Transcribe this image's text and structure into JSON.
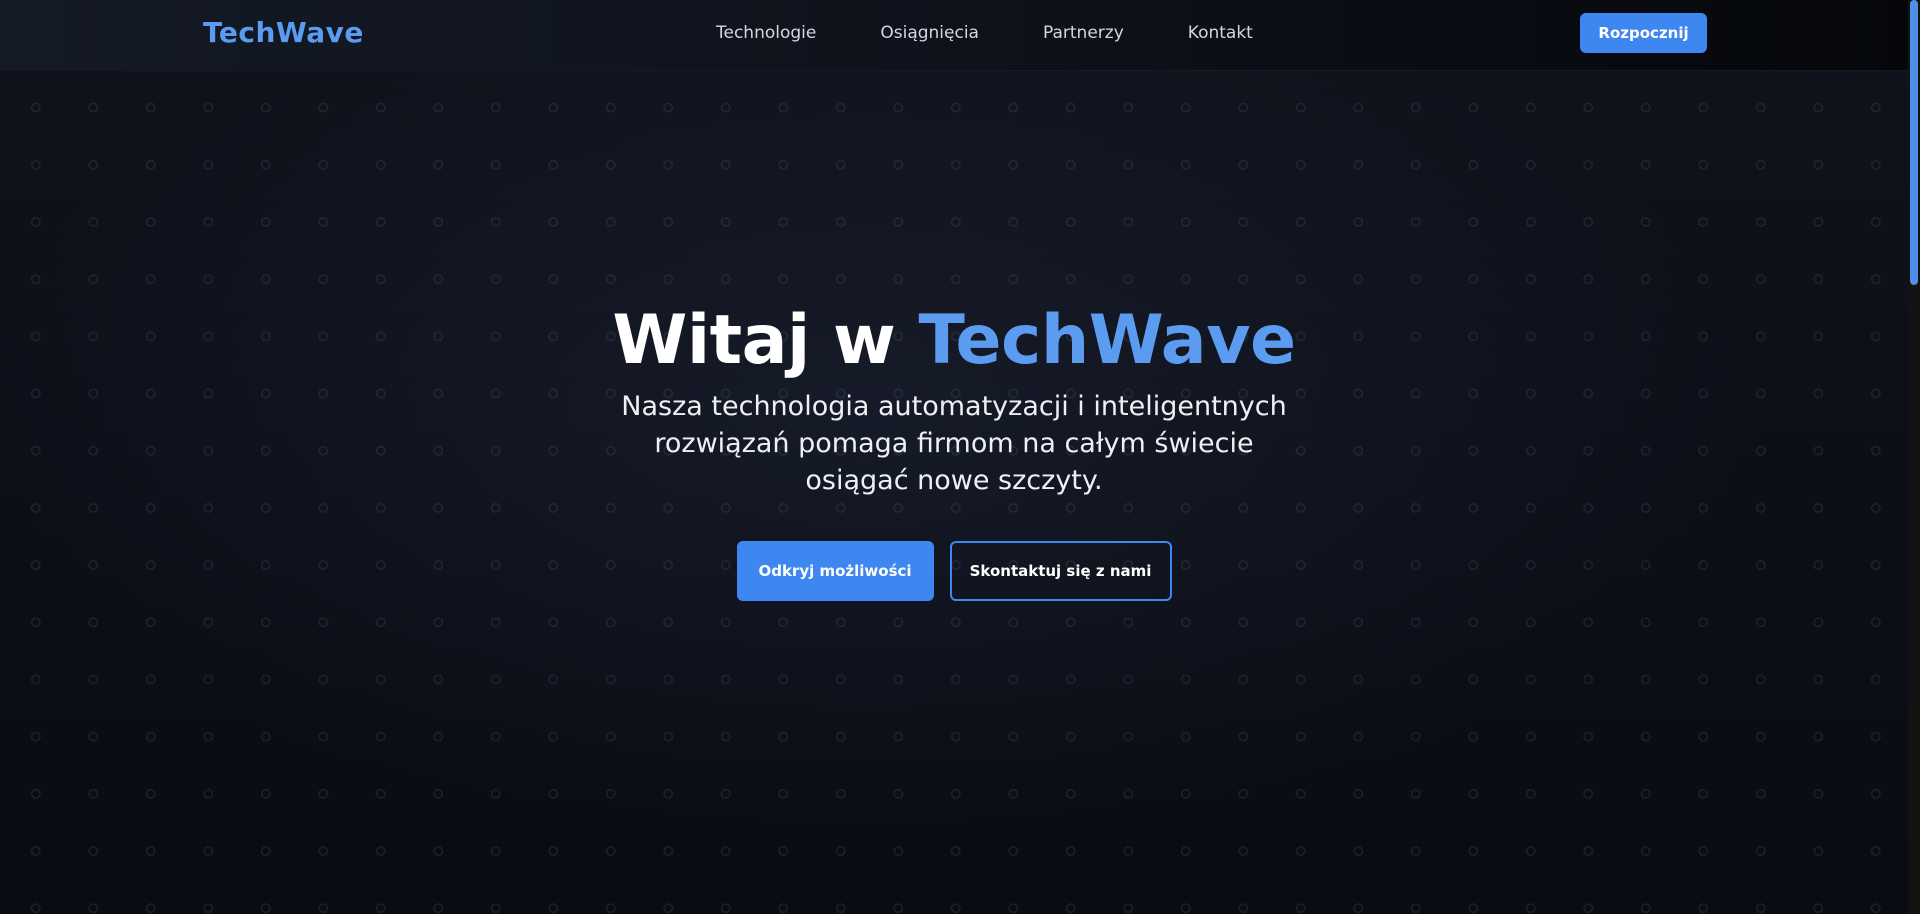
{
  "brand": {
    "logo_text": "TechWave",
    "accent_color": "#5b9cf0",
    "button_color": "#3f87f0"
  },
  "nav": {
    "items": [
      {
        "label": "Technologie"
      },
      {
        "label": "Osiągnięcia"
      },
      {
        "label": "Partnerzy"
      },
      {
        "label": "Kontakt"
      }
    ],
    "cta_label": "Rozpocznij"
  },
  "hero": {
    "title_prefix": "Witaj w ",
    "title_accent": "TechWave",
    "subtitle": "Nasza technologia automatyzacji i inteligentnych rozwiązań pomaga firmom na całym świecie osiągać nowe szczyty.",
    "primary_button": "Odkryj możliwości",
    "secondary_button": "Skontaktuj się z nami"
  }
}
